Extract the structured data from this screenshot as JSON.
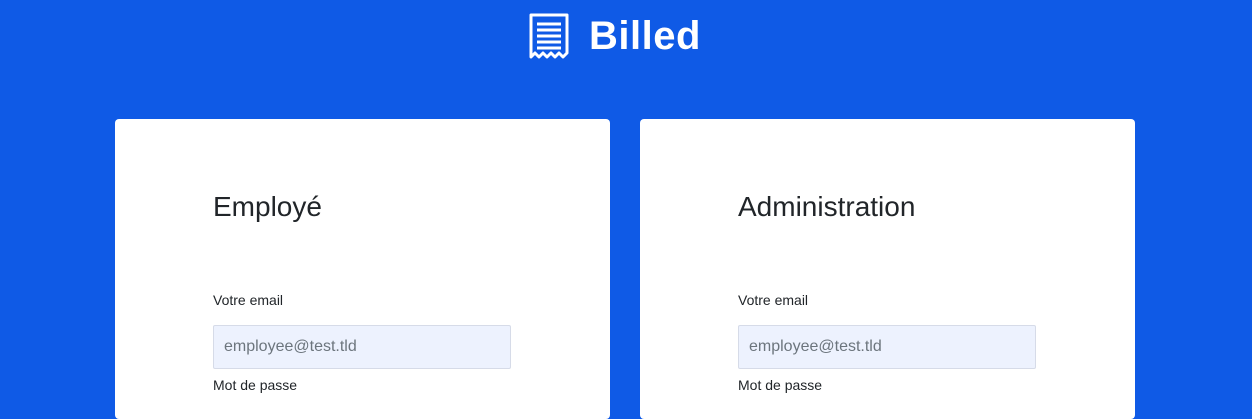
{
  "header": {
    "title": "Billed",
    "icon": "receipt-icon",
    "background": "#0f5ae6"
  },
  "cards": [
    {
      "title": "Employé",
      "email_label": "Votre email",
      "email_placeholder": "employee@test.tld",
      "password_label": "Mot de passe"
    },
    {
      "title": "Administration",
      "email_label": "Votre email",
      "email_placeholder": "employee@test.tld",
      "password_label": "Mot de passe"
    }
  ]
}
